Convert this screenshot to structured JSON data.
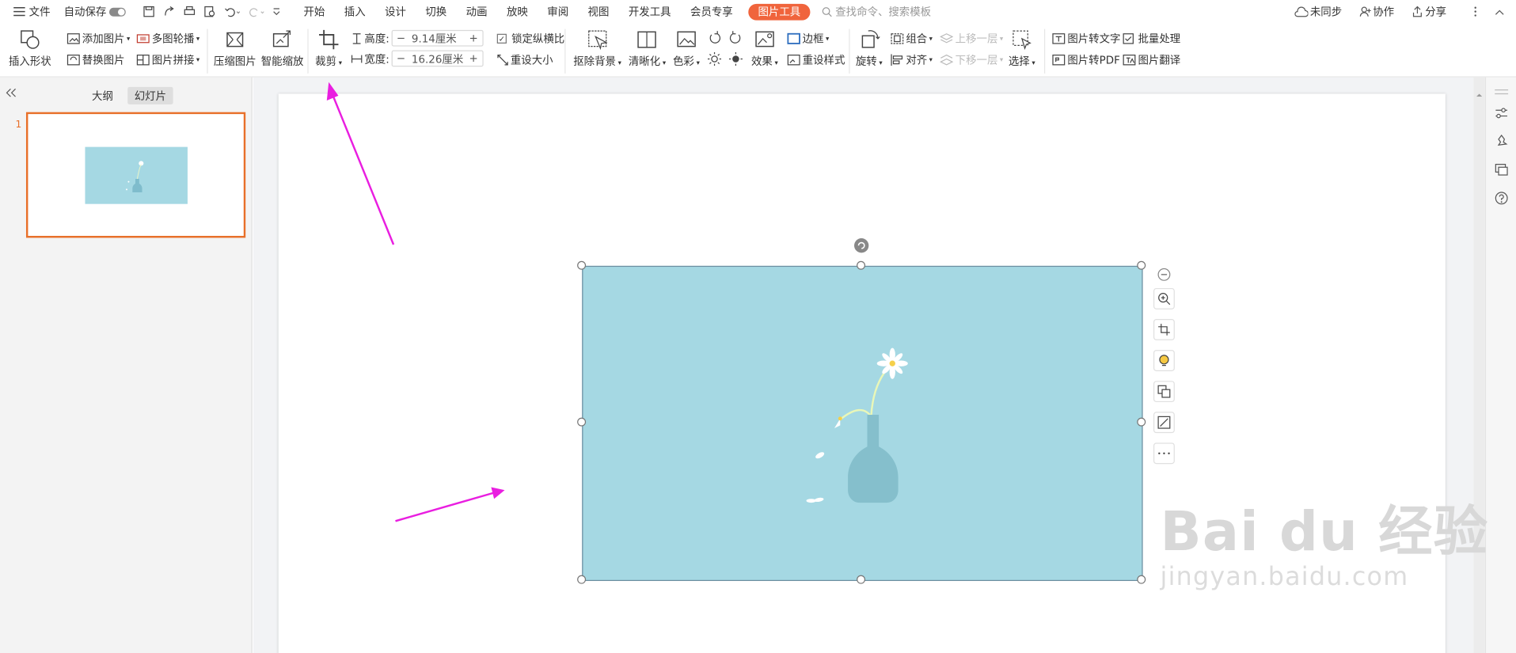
{
  "menu": {
    "file_label": "文件",
    "autosave_label": "自动保存",
    "tabs": [
      "开始",
      "插入",
      "设计",
      "切换",
      "动画",
      "放映",
      "审阅",
      "视图",
      "开发工具",
      "会员专享"
    ],
    "active_tab": "图片工具",
    "search_placeholder": "查找命令、搜索模板",
    "sync_label": "未同步",
    "collab_label": "协作",
    "share_label": "分享"
  },
  "ribbon": {
    "insert_shape": "插入形状",
    "add_picture": "添加图片",
    "replace_picture": "替换图片",
    "multi_carousel": "多图轮播",
    "picture_collage": "图片拼接",
    "compress_picture": "压缩图片",
    "smart_zoom": "智能缩放",
    "crop": "裁剪",
    "height_label": "高度:",
    "height_value": "9.14厘米",
    "width_label": "宽度:",
    "width_value": "16.26厘米",
    "lock_ratio": "锁定纵横比",
    "reset_size": "重设大小",
    "remove_bg": "抠除背景",
    "sharpen": "清晰化",
    "color": "色彩",
    "effects": "效果",
    "border": "边框",
    "reset_style": "重设样式",
    "rotate": "旋转",
    "group": "组合",
    "align": "对齐",
    "bring_forward": "上移一层",
    "send_backward": "下移一层",
    "select": "选择",
    "pic_to_text": "图片转文字",
    "batch_process": "批量处理",
    "pic_to_pdf": "图片转PDF",
    "pic_translate": "图片翻译"
  },
  "left_pane": {
    "tab_outline": "大纲",
    "tab_slides": "幻灯片",
    "slide_number": "1"
  },
  "watermark": {
    "logo_text": "Bai du 经验",
    "url_text": "jingyan.baidu.com"
  },
  "colors": {
    "accent": "#f0643c",
    "picture_bg": "#a5d8e3",
    "arrow": "#e91ee0",
    "thumb_border": "#e8702a"
  }
}
